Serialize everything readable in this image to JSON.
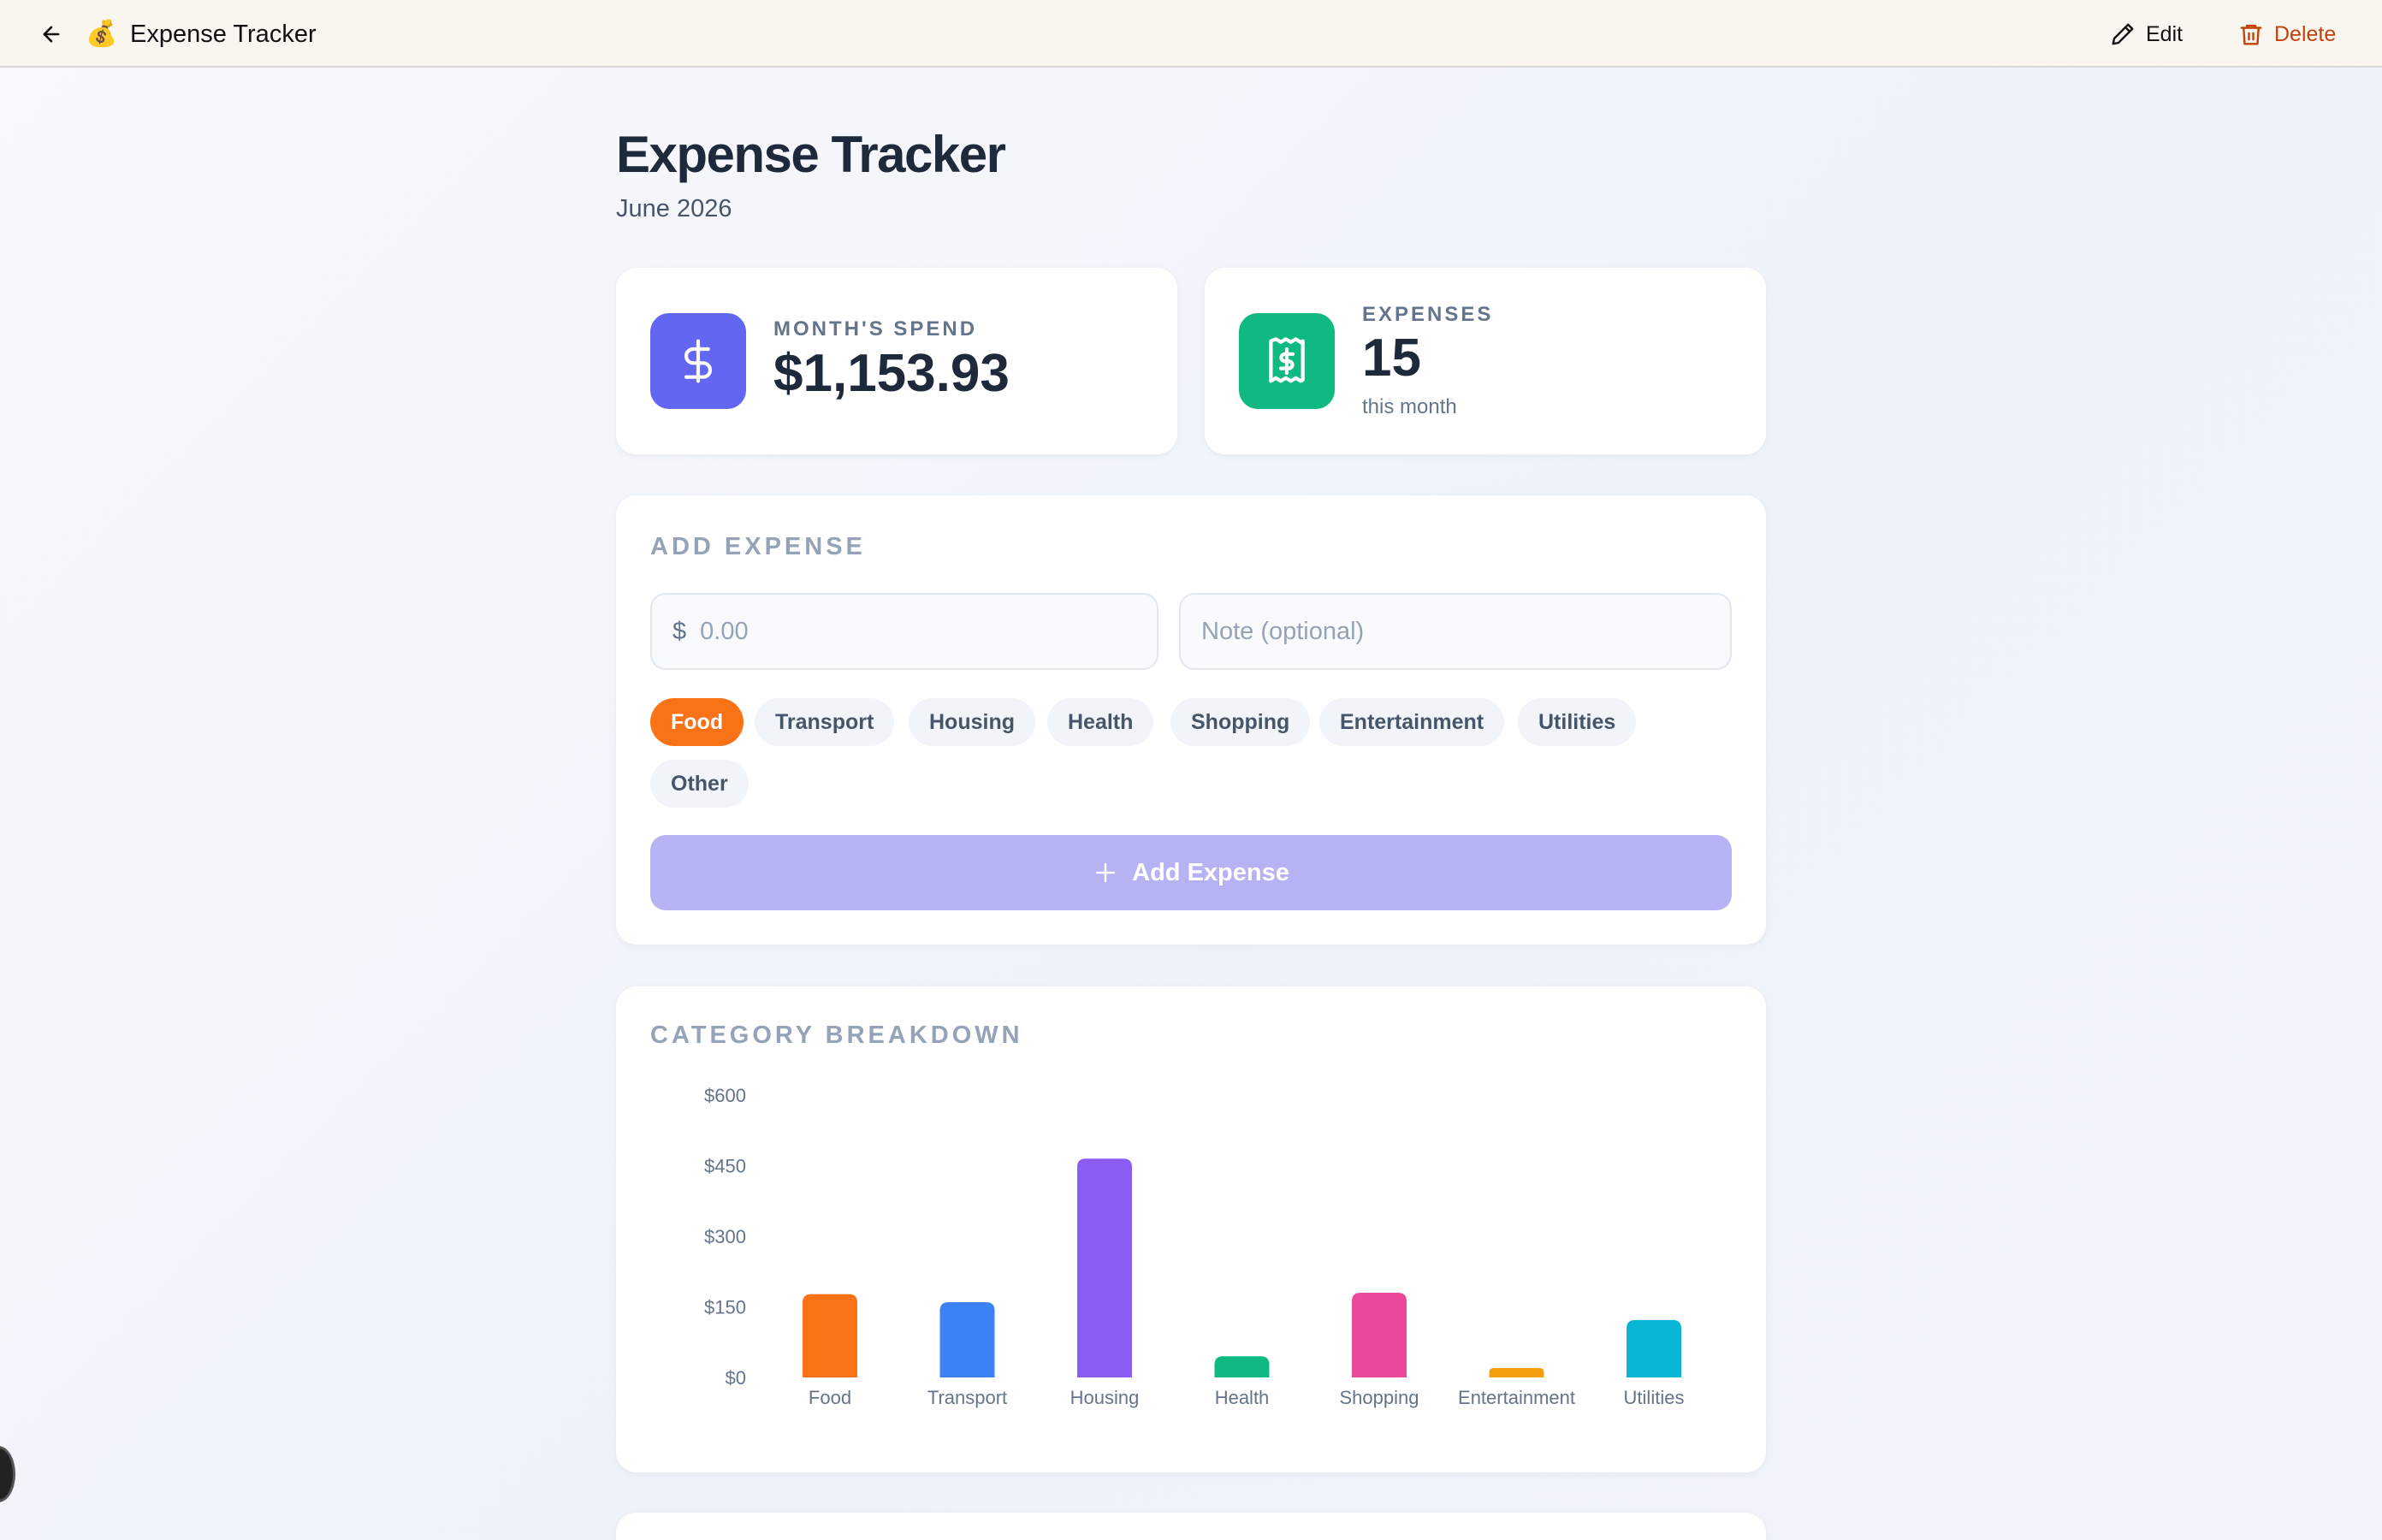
{
  "topbar": {
    "logo_emoji": "💰",
    "title": "Expense Tracker",
    "edit_label": "Edit",
    "delete_label": "Delete"
  },
  "header": {
    "title": "Expense Tracker",
    "subtitle": "June 2026"
  },
  "stats": {
    "spend_label": "MONTH'S SPEND",
    "spend_value": "$1,153.93",
    "expenses_label": "EXPENSES",
    "expenses_value": "15",
    "expenses_note": "this month"
  },
  "add_expense": {
    "heading": "ADD EXPENSE",
    "currency_symbol": "$",
    "amount_placeholder": "0.00",
    "note_placeholder": "Note (optional)",
    "categories": [
      "Food",
      "Transport",
      "Housing",
      "Health",
      "Shopping",
      "Entertainment",
      "Utilities",
      "Other"
    ],
    "selected_category": "Food",
    "button_label": "Add Expense"
  },
  "breakdown": {
    "heading": "CATEGORY BREAKDOWN"
  },
  "chart_data": {
    "type": "bar",
    "categories": [
      "Food",
      "Transport",
      "Housing",
      "Health",
      "Shopping",
      "Entertainment",
      "Utilities"
    ],
    "values": [
      177,
      160,
      465,
      45,
      180,
      20,
      122
    ],
    "colors": [
      "#f97316",
      "#3b82f6",
      "#8b5cf6",
      "#10b981",
      "#ec4899",
      "#f59e0b",
      "#06b6d4"
    ],
    "yticks": [
      "$0",
      "$150",
      "$300",
      "$450",
      "$600"
    ],
    "ylim": [
      0,
      600
    ],
    "grid": false
  },
  "colors": {
    "accent": "#6366f1",
    "success": "#10b981",
    "danger": "#c2410c",
    "active_chip": "#f97316"
  }
}
